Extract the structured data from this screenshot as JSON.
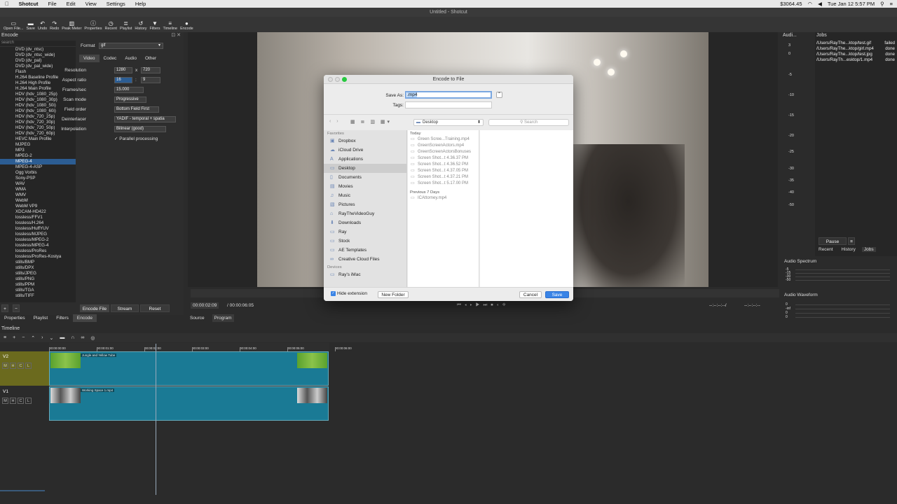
{
  "menubar": {
    "apple": "",
    "app": "Shotcut",
    "items": [
      "File",
      "Edit",
      "View",
      "Settings",
      "Help"
    ],
    "price": "$3064.45",
    "clock": "Tue Jan 12  5:57 PM"
  },
  "window": {
    "title": "Untitled - Shotcut"
  },
  "toolbar": [
    {
      "label": "Open File...",
      "icon": "open-folder-icon",
      "glyph": "▭"
    },
    {
      "label": "Save",
      "icon": "save-icon",
      "glyph": "▬"
    },
    {
      "label": "Undo",
      "icon": "undo-icon",
      "glyph": "↶"
    },
    {
      "label": "Redo",
      "icon": "redo-icon",
      "glyph": "↷"
    },
    {
      "label": "Peak Meter",
      "icon": "peak-meter-icon",
      "glyph": "▥"
    },
    {
      "label": "Properties",
      "icon": "properties-icon",
      "glyph": "ⓘ"
    },
    {
      "label": "Recent",
      "icon": "recent-icon",
      "glyph": "◷"
    },
    {
      "label": "Playlist",
      "icon": "playlist-icon",
      "glyph": "≣"
    },
    {
      "label": "History",
      "icon": "history-icon",
      "glyph": "↺"
    },
    {
      "label": "Filters",
      "icon": "filters-icon",
      "glyph": "▼"
    },
    {
      "label": "Timeline",
      "icon": "timeline-icon",
      "glyph": "≡"
    },
    {
      "label": "Encode",
      "icon": "encode-icon",
      "glyph": "●"
    }
  ],
  "encode": {
    "title": "Encode",
    "search": "search",
    "presets": [
      "DVD (dv_ntsc)",
      "DVD (dv_ntsc_wide)",
      "DVD (dv_pal)",
      "DVD (dv_pal_wide)",
      "Flash",
      "H.264 Baseline Profile",
      "H.264 High Profile",
      "H.264 Main Profile",
      "HDV (hdv_1080_25p)",
      "HDV (hdv_1080_30p)",
      "HDV (hdv_1080_50i)",
      "HDV (hdv_1080_60i)",
      "HDV (hdv_720_25p)",
      "HDV (hdv_720_30p)",
      "HDV (hdv_720_50p)",
      "HDV (hdv_720_60p)",
      "HEVC Main Profile",
      "MJPEG",
      "MP3",
      "MPEG-2",
      "MPEG-4",
      "MPEG-4-ASP",
      "Ogg Vorbis",
      "Sony-PSP",
      "WAV",
      "WMA",
      "WMV",
      "WebM",
      "WebM VP9",
      "XDCAM-HD422",
      "lossless/FFV1",
      "lossless/H.264",
      "lossless/HuffYUV",
      "lossless/MJPEG",
      "lossless/MPEG-2",
      "lossless/MPEG-4",
      "lossless/ProRes",
      "lossless/ProRes-Kostya",
      "stills/BMP",
      "stills/DPX",
      "stills/JPEG",
      "stills/PNG",
      "stills/PPM",
      "stills/TGA",
      "stills/TIFF"
    ],
    "selected_index": 20,
    "format_label": "Format",
    "format_value": "gif",
    "tabs": [
      "Video",
      "Codec",
      "Audio",
      "Other"
    ],
    "resolution_label": "Resolution",
    "res_w": "1280",
    "res_x": "x",
    "res_h": "720",
    "aspect_label": "Aspect ratio",
    "aspect_w": "16",
    "aspect_colon": ":",
    "aspect_h": "9",
    "fps_label": "Frames/sec",
    "fps": "15.000",
    "scan_label": "Scan mode",
    "scan": "Progressive",
    "field_label": "Field order",
    "field": "Bottom Field First",
    "deint_label": "Deinterlacer",
    "deint": "YADIF - temporal + spatia",
    "interp_label": "Interpolation",
    "interp": "Bilinear (good)",
    "parallel_check": "✓",
    "parallel": "Parallel processing",
    "btn_encode_file": "Encode File",
    "btn_stream": "Stream",
    "btn_reset": "Reset",
    "add": "+",
    "remove": "−"
  },
  "bottomtabs": [
    "Properties",
    "Playlist",
    "Filters",
    "Encode"
  ],
  "bottomtab_active": 3,
  "player": {
    "timecode": "00:00:02:09",
    "duration": "/ 00:00:06:05",
    "in": "--:--:--:--/",
    "out": "--:--:--:--",
    "source": "Source",
    "program": "Program"
  },
  "meter": {
    "title": "Audi...",
    "scale": [
      "3",
      "0",
      "-5",
      "-10",
      "-15",
      "-20",
      "-25",
      "-30",
      "-35",
      "-40",
      "-50"
    ]
  },
  "jobs": {
    "title": "Jobs",
    "items": [
      {
        "path": "/Users/RayThe...ktop/test.gif",
        "status": "failed"
      },
      {
        "path": "/Users/RayThe...ktop/girl.mp4",
        "status": "done"
      },
      {
        "path": "/Users/RayThe...ktop/test.jpg",
        "status": "done"
      },
      {
        "path": "/Users/RayTh...esktop/1.mp4",
        "status": "done"
      }
    ],
    "pause": "Pause",
    "menu": "≡",
    "tabs": [
      "Recent",
      "History",
      "Jobs"
    ]
  },
  "spectrum": {
    "title": "Audio Spectrum",
    "scale": [
      "-5",
      "-15",
      "-30",
      "-50"
    ]
  },
  "waveform": {
    "title": "Audio Waveform",
    "scale": [
      "0",
      "-inf",
      "0",
      "0"
    ]
  },
  "dialog": {
    "title": "Encode to File",
    "save_as_label": "Save As:",
    "save_as_value": ".mp4",
    "tags_label": "Tags:",
    "location": "Desktop",
    "search_placeholder": "Search",
    "favorites_header": "Favorites",
    "favorites": [
      {
        "label": "Dropbox",
        "icon": "dropbox-icon",
        "glyph": "▣"
      },
      {
        "label": "iCloud Drive",
        "icon": "cloud-icon",
        "glyph": "☁"
      },
      {
        "label": "Applications",
        "icon": "applications-icon",
        "glyph": "A"
      },
      {
        "label": "Desktop",
        "icon": "desktop-icon",
        "glyph": "▭"
      },
      {
        "label": "Documents",
        "icon": "documents-icon",
        "glyph": "▯"
      },
      {
        "label": "Movies",
        "icon": "movies-icon",
        "glyph": "▤"
      },
      {
        "label": "Music",
        "icon": "music-icon",
        "glyph": "♫"
      },
      {
        "label": "Pictures",
        "icon": "pictures-icon",
        "glyph": "▧"
      },
      {
        "label": "RayTheVideoGuy",
        "icon": "home-icon",
        "glyph": "⌂"
      },
      {
        "label": "Downloads",
        "icon": "downloads-icon",
        "glyph": "⬇"
      },
      {
        "label": "Ray",
        "icon": "folder-icon",
        "glyph": "▭"
      },
      {
        "label": "Stock",
        "icon": "folder-icon",
        "glyph": "▭"
      },
      {
        "label": "AE Templates",
        "icon": "folder-icon",
        "glyph": "▭"
      },
      {
        "label": "Creative Cloud Files",
        "icon": "creative-cloud-icon",
        "glyph": "∞"
      }
    ],
    "selected_favorite": 3,
    "devices_header": "Devices",
    "devices": [
      {
        "label": "Ray's iMac",
        "icon": "imac-icon",
        "glyph": "▭"
      }
    ],
    "today_header": "Today",
    "today_files": [
      "Green Scree...Training.mp4",
      "GreenScreenActors.mp4",
      "GreenScreenActorsBonuses",
      "Screen Shot...t 4.36.37 PM",
      "Screen Shot...t 4.36.52 PM",
      "Screen Shot...t 4.37.05 PM",
      "Screen Shot...t 4.37.21 PM",
      "Screen Shot...t 5.17.00 PM"
    ],
    "prev_header": "Previous 7 Days",
    "prev_files": [
      "ICAttorney.mp4"
    ],
    "hide_ext_label": "Hide extension",
    "new_folder": "New Folder",
    "cancel": "Cancel",
    "save": "Save"
  },
  "timeline": {
    "title": "Timeline",
    "ruler": [
      "00:00:00:00",
      "00:00:01:00",
      "00:00:02:00",
      "00:00:03:00",
      "00:00:04:00",
      "00:00:05:00",
      "00:00:06:00"
    ],
    "tracks": [
      {
        "name": "V2",
        "clip": "Jungle and Yellow Tube"
      },
      {
        "name": "V1",
        "clip": "Working Space 1.mp4"
      }
    ],
    "track_btns": [
      "M",
      "H",
      "C",
      "L"
    ]
  }
}
